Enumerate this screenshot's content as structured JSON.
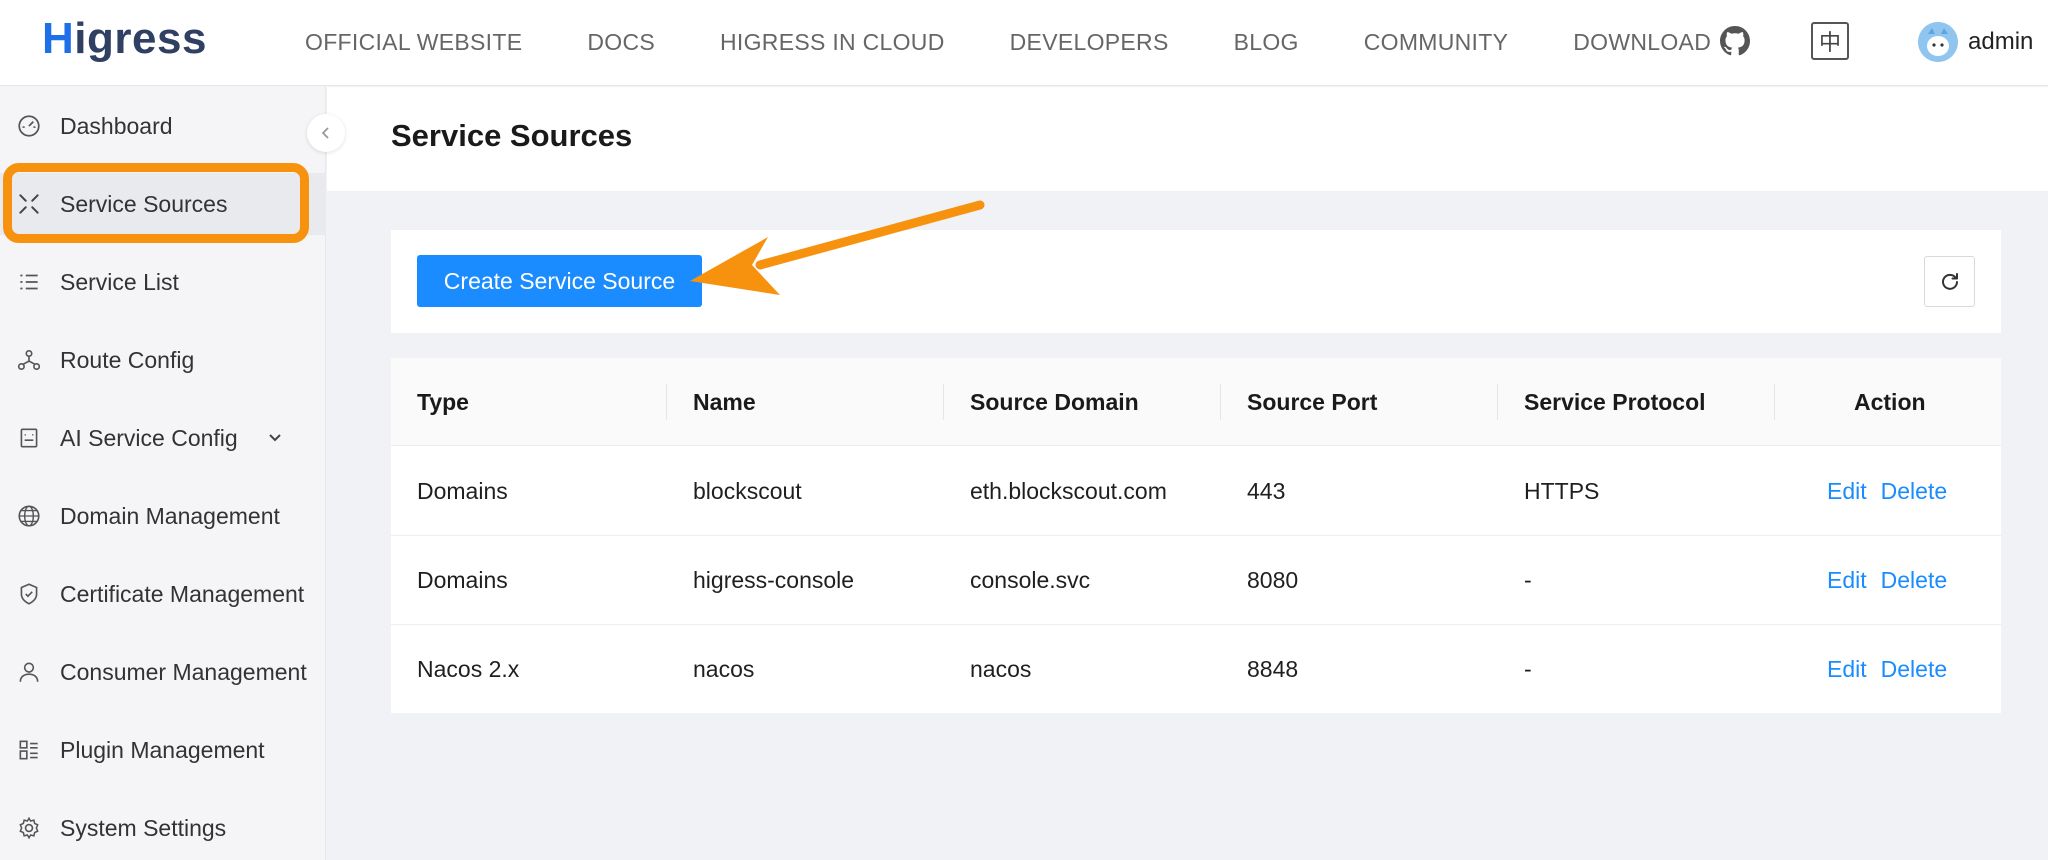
{
  "app": {
    "logo_text_first": "H",
    "logo_text_rest": "igress"
  },
  "nav": [
    {
      "label": "OFFICIAL WEBSITE"
    },
    {
      "label": "DOCS"
    },
    {
      "label": "HIGRESS IN CLOUD"
    },
    {
      "label": "DEVELOPERS"
    },
    {
      "label": "BLOG"
    },
    {
      "label": "COMMUNITY"
    },
    {
      "label": "DOWNLOAD"
    }
  ],
  "header": {
    "lang_label": "中",
    "user_name": "admin"
  },
  "sidebar": {
    "items": [
      {
        "label": "Dashboard",
        "icon": "dashboard-icon"
      },
      {
        "label": "Service Sources",
        "icon": "service-sources-icon"
      },
      {
        "label": "Service List",
        "icon": "list-icon"
      },
      {
        "label": "Route Config",
        "icon": "route-icon"
      },
      {
        "label": "AI Service Config",
        "icon": "ai-icon"
      },
      {
        "label": "Domain Management",
        "icon": "globe-icon"
      },
      {
        "label": "Certificate Management",
        "icon": "shield-icon"
      },
      {
        "label": "Consumer Management",
        "icon": "user-icon"
      },
      {
        "label": "Plugin Management",
        "icon": "plugin-icon"
      },
      {
        "label": "System Settings",
        "icon": "gear-icon"
      }
    ],
    "active_index": 1
  },
  "page": {
    "title": "Service Sources",
    "create_label": "Create Service Source"
  },
  "table": {
    "columns": [
      "Type",
      "Name",
      "Source Domain",
      "Source Port",
      "Service Protocol",
      "Action"
    ],
    "rows": [
      {
        "type": "Domains",
        "name": "blockscout",
        "domain": "eth.blockscout.com",
        "port": "443",
        "protocol": "HTTPS",
        "edit": "Edit",
        "delete": "Delete"
      },
      {
        "type": "Domains",
        "name": "higress-console",
        "domain": "console.svc",
        "port": "8080",
        "protocol": "-",
        "edit": "Edit",
        "delete": "Delete"
      },
      {
        "type": "Nacos 2.x",
        "name": "nacos",
        "domain": "nacos",
        "port": "8848",
        "protocol": "-",
        "edit": "Edit",
        "delete": "Delete"
      }
    ]
  },
  "colors": {
    "primary": "#1a8cff",
    "highlight": "#f7920f"
  }
}
